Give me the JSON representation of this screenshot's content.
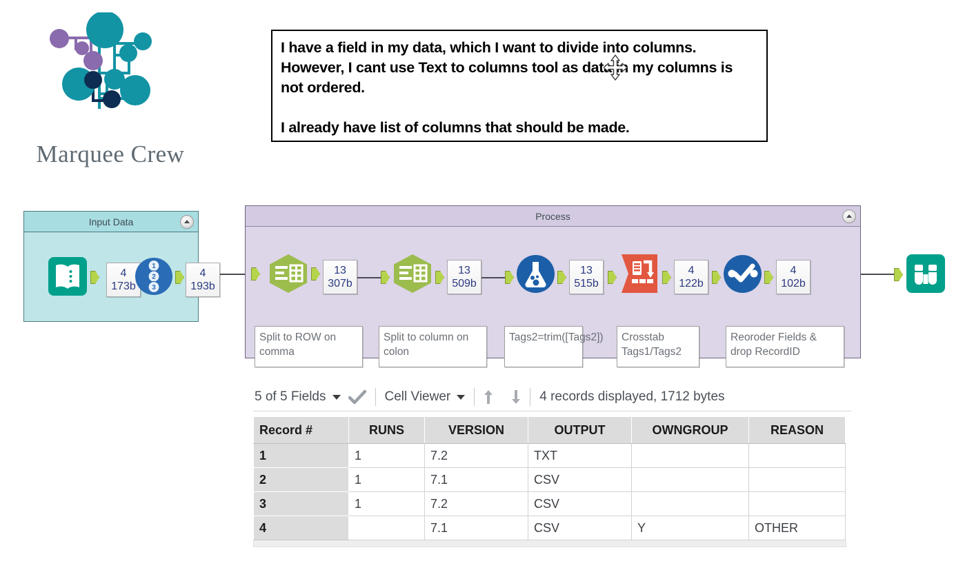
{
  "logo": {
    "wordmark": "Marquee Crew",
    "colors": {
      "teal": "#1394a5",
      "purple": "#8a6bad",
      "navy": "#0e2d52"
    }
  },
  "callout": {
    "line1": "I have a field in my data, which I want to divide into columns. However, I cant use Text to columns tool as data in my columns is not ordered.",
    "line2": "I already have list of columns that should be made.",
    "cursor_icon": "move-cursor-icon"
  },
  "canvas": {
    "containers": [
      {
        "id": "input",
        "title": "Input Data",
        "collapse_icon": "collapse-chevron-icon"
      },
      {
        "id": "process",
        "title": "Process",
        "collapse_icon": "collapse-chevron-icon"
      }
    ],
    "input_tools": [
      {
        "icon": "input-data-book-icon",
        "label": ""
      },
      {
        "icon": "record-id-icon",
        "label": ""
      }
    ],
    "input_databoxes": [
      {
        "records": "4",
        "size": "173b"
      },
      {
        "records": "4",
        "size": "193b"
      }
    ],
    "process_tools": [
      {
        "icon": "text-to-columns-icon",
        "annotation": "Split to ROW on comma"
      },
      {
        "icon": "text-to-columns-icon",
        "annotation": "Split to column on colon"
      },
      {
        "icon": "formula-flask-icon",
        "annotation": "Tags2=trim([Tags2])"
      },
      {
        "icon": "crosstab-icon",
        "annotation": "Crosstab Tags1/Tags2"
      },
      {
        "icon": "select-check-icon",
        "annotation": "Reoroder Fields & drop RecordID"
      }
    ],
    "process_databoxes": [
      {
        "records": "13",
        "size": "307b"
      },
      {
        "records": "13",
        "size": "509b"
      },
      {
        "records": "13",
        "size": "515b"
      },
      {
        "records": "4",
        "size": "122b"
      },
      {
        "records": "4",
        "size": "102b"
      }
    ],
    "browse_tool": {
      "icon": "browse-binoculars-icon"
    }
  },
  "results": {
    "fields_label": "5 of 5 Fields",
    "fields_caret": "chevron-down-icon",
    "fields_check": "check-icon",
    "viewer_label": "Cell Viewer",
    "viewer_caret": "chevron-down-icon",
    "sort_up": "arrow-up-icon",
    "sort_down": "arrow-down-icon",
    "status": "4 records displayed, 1712 bytes",
    "columns": [
      "Record #",
      "RUNS",
      "VERSION",
      "OUTPUT",
      "OWNGROUP",
      "REASON"
    ],
    "rows": [
      {
        "record": "1",
        "RUNS": "1",
        "VERSION": "7.2",
        "OUTPUT": "TXT",
        "OWNGROUP": "",
        "REASON": ""
      },
      {
        "record": "2",
        "RUNS": "1",
        "VERSION": "7.1",
        "OUTPUT": "CSV",
        "OWNGROUP": "",
        "REASON": ""
      },
      {
        "record": "3",
        "RUNS": "1",
        "VERSION": "7.2",
        "OUTPUT": "CSV",
        "OWNGROUP": "",
        "REASON": ""
      },
      {
        "record": "4",
        "RUNS": "",
        "VERSION": "7.1",
        "OUTPUT": "CSV",
        "OWNGROUP": "Y",
        "REASON": "OTHER"
      }
    ]
  }
}
